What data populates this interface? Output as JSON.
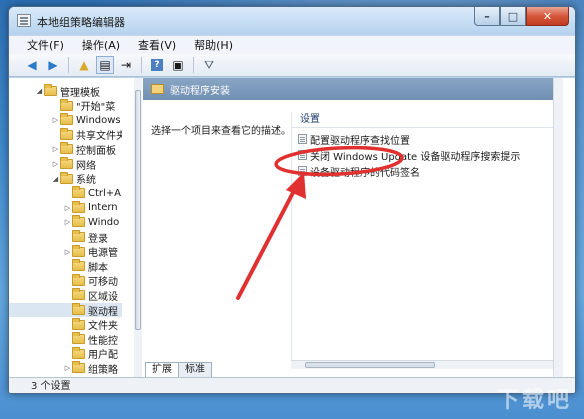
{
  "window": {
    "title": "本地组策略编辑器",
    "minimize_glyph": "–",
    "maximize_glyph": "□",
    "close_glyph": "✕"
  },
  "menu": [
    "文件(F)",
    "操作(A)",
    "查看(V)",
    "帮助(H)"
  ],
  "toolbar": {
    "back_glyph": "◀",
    "forward_glyph": "▶",
    "up_glyph": "▲",
    "view_glyph": "▤",
    "export_glyph": "⇥",
    "help_glyph": "?",
    "props_glyph": "▣",
    "filter_glyph": "⛛"
  },
  "tree": {
    "items": [
      {
        "label": "管理模板",
        "expander": "◢",
        "level": 1,
        "selected": false
      },
      {
        "label": "\"开始\"菜",
        "expander": "",
        "level": 2,
        "selected": false
      },
      {
        "label": "Windows",
        "expander": "▷",
        "level": 2,
        "selected": false
      },
      {
        "label": "共享文件夹",
        "expander": "",
        "level": 2,
        "selected": false
      },
      {
        "label": "控制面板",
        "expander": "▷",
        "level": 2,
        "selected": false
      },
      {
        "label": "网络",
        "expander": "▷",
        "level": 2,
        "selected": false
      },
      {
        "label": "系统",
        "expander": "◢",
        "level": 2,
        "selected": false
      },
      {
        "label": "Ctrl+A",
        "expander": "",
        "level": 3,
        "selected": false
      },
      {
        "label": "Intern",
        "expander": "▷",
        "level": 3,
        "selected": false
      },
      {
        "label": "Windo",
        "expander": "▷",
        "level": 3,
        "selected": false
      },
      {
        "label": "登录",
        "expander": "",
        "level": 3,
        "selected": false
      },
      {
        "label": "电源管",
        "expander": "▷",
        "level": 3,
        "selected": false
      },
      {
        "label": "脚本",
        "expander": "",
        "level": 3,
        "selected": false
      },
      {
        "label": "可移动",
        "expander": "",
        "level": 3,
        "selected": false
      },
      {
        "label": "区域设",
        "expander": "",
        "level": 3,
        "selected": false
      },
      {
        "label": "驱动程",
        "expander": "",
        "level": 3,
        "selected": true
      },
      {
        "label": "文件夹",
        "expander": "",
        "level": 3,
        "selected": false
      },
      {
        "label": "性能控",
        "expander": "",
        "level": 3,
        "selected": false
      },
      {
        "label": "用户配",
        "expander": "",
        "level": 3,
        "selected": false
      },
      {
        "label": "组策略",
        "expander": "▷",
        "level": 3,
        "selected": false
      }
    ]
  },
  "right": {
    "header": "驱动程序安装",
    "description": "选择一个项目来查看它的描述。",
    "column_header": "设置",
    "settings": [
      "配置驱动程序查找位置",
      "关闭 Windows Update 设备驱动程序搜索提示",
      "设备驱动程序的代码签名"
    ]
  },
  "tabs": [
    "扩展",
    "标准"
  ],
  "status": "3 个设置",
  "annotation": {
    "color": "#e03030"
  },
  "watermark": "下载吧"
}
